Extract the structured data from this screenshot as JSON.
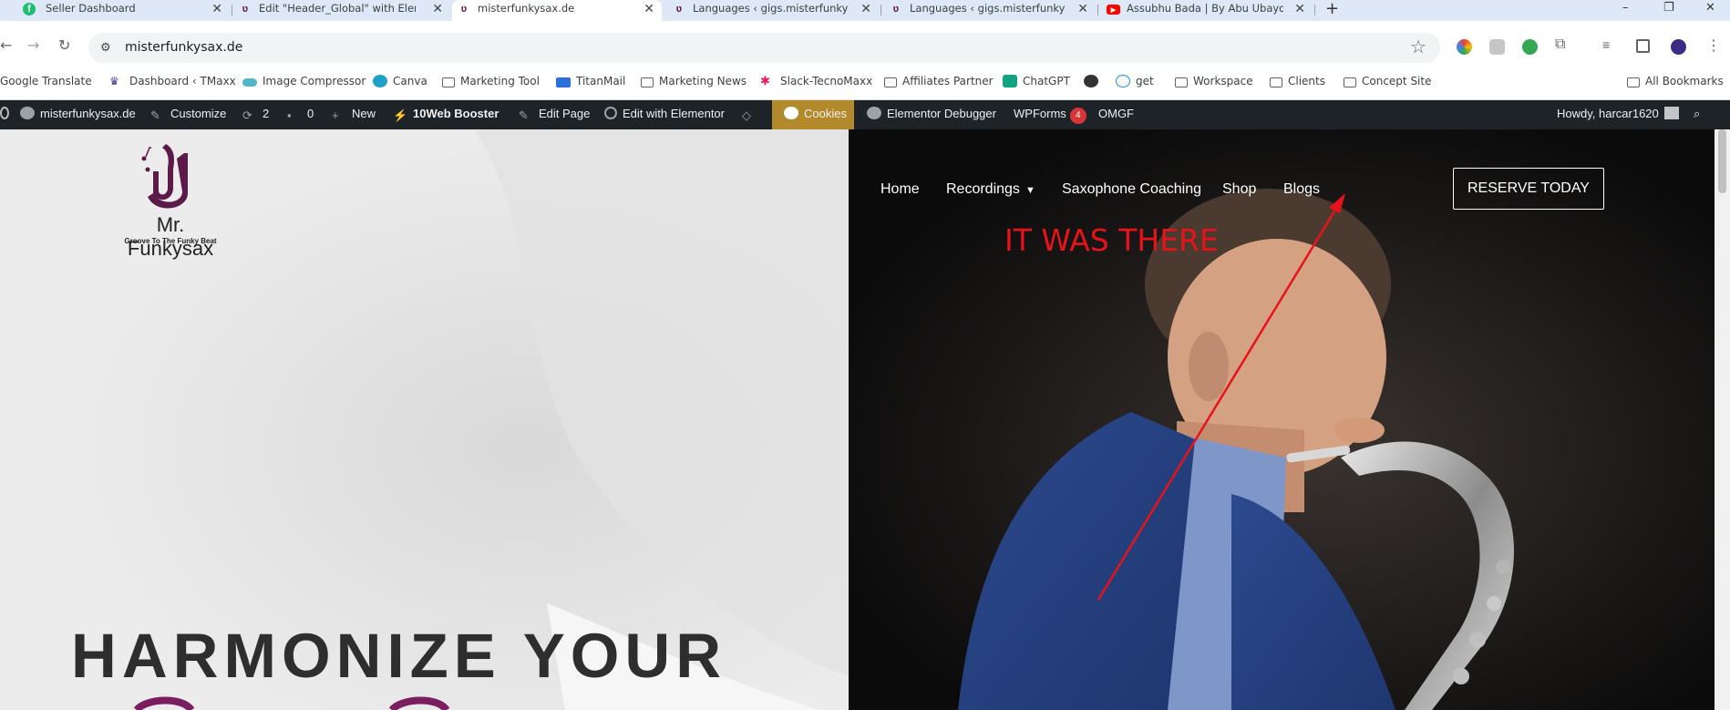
{
  "browser": {
    "tabs": [
      {
        "label": "Seller Dashboard",
        "icon": "fiverr-icon"
      },
      {
        "label": "Edit \"Header_Global\" with Elem",
        "icon": "site-icon"
      },
      {
        "label": "misterfunkysax.de",
        "icon": "site-icon",
        "active": true
      },
      {
        "label": "Languages ‹ gigs.misterfunkysa",
        "icon": "site-icon"
      },
      {
        "label": "Languages ‹ gigs.misterfunkysa",
        "icon": "site-icon"
      },
      {
        "label": "Assubhu Bada | By Abu Ubayda",
        "icon": "youtube-icon"
      }
    ],
    "new_tab": "+",
    "window_controls": [
      "–",
      "❐",
      "✕"
    ],
    "close_glyph": "✕",
    "url": "misterfunkysax.de"
  },
  "bookmarks": [
    {
      "label": "Google Translate"
    },
    {
      "label": "Dashboard ‹ TMaxx"
    },
    {
      "label": "Image Compressor"
    },
    {
      "label": "Canva"
    },
    {
      "label": "Marketing Tool"
    },
    {
      "label": "TitanMail"
    },
    {
      "label": "Marketing News"
    },
    {
      "label": "Slack-TecnoMaxx"
    },
    {
      "label": "Affiliates Partner"
    },
    {
      "label": "ChatGPT"
    },
    {
      "label": ""
    },
    {
      "label": "get"
    },
    {
      "label": "Workspace"
    },
    {
      "label": "Clients"
    },
    {
      "label": "Concept Site"
    }
  ],
  "all_bookmarks": "All Bookmarks",
  "wp_admin_bar": {
    "site": "misterfunkysax.de",
    "customize": "Customize",
    "updates": "2",
    "comments": "0",
    "new": "New",
    "booster": "10Web Booster",
    "edit_page": "Edit Page",
    "edit_elementor": "Edit with Elementor",
    "cookies": "Cookies",
    "debugger": "Elementor Debugger",
    "wpforms": "WPForms",
    "wpforms_count": "4",
    "omgf": "OMGF",
    "howdy": "Howdy, harcar1620"
  },
  "site": {
    "logo_name": "Mr. Funkysax",
    "logo_tagline": "Groove To The Funky Beat",
    "menu": [
      "Home",
      "Recordings",
      "Saxophone Coaching",
      "Shop",
      "Blogs"
    ],
    "cta": "RESERVE TODAY",
    "hero_title": "HARMONIZE YOUR"
  },
  "annotation": "IT WAS THERE",
  "colors": {
    "wp_bar": "#1d2327",
    "cookies": "#b2892b",
    "annotation": "#e8131a",
    "brand": "#5c1a4a"
  }
}
